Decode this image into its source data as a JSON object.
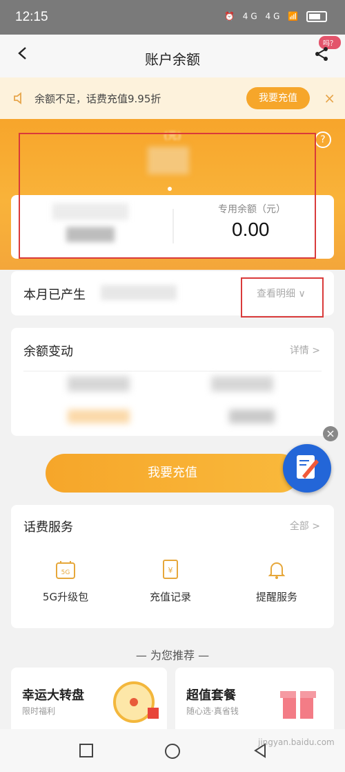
{
  "status": {
    "time": "12:15",
    "icons": "⏰ 4G 4G 📶",
    "battery": ""
  },
  "nav": {
    "title": "账户余额",
    "pill": "吗？"
  },
  "notice": {
    "text": "余额不足，话费充值9.95折",
    "button": "我要充值",
    "close": "×"
  },
  "balance": {
    "general_label": "(元)",
    "dedicated_label": "专用余额（元）",
    "dedicated_value": "0.00",
    "help": "?"
  },
  "month": {
    "title_prefix": "本月已产生",
    "detail": "查看明细 ∨"
  },
  "change": {
    "title": "余额变动",
    "detail": "详情 >"
  },
  "recharge": {
    "label": "我要充值"
  },
  "services": {
    "title": "话费服务",
    "all": "全部 >",
    "items": [
      {
        "label": "5G升级包",
        "icon": "5g-package-icon"
      },
      {
        "label": "充值记录",
        "icon": "recharge-record-icon"
      },
      {
        "label": "提醒服务",
        "icon": "bell-icon"
      }
    ]
  },
  "recommend": {
    "header": "— 为您推荐 —",
    "cards": [
      {
        "title": "幸运大转盘",
        "subtitle": "限时福利"
      },
      {
        "title": "超值套餐",
        "subtitle": "随心选·真省钱"
      }
    ]
  },
  "watermark": "jingyan.baidu.com",
  "colors": {
    "accent": "#f6a62a",
    "highlight": "#d93a3a"
  }
}
